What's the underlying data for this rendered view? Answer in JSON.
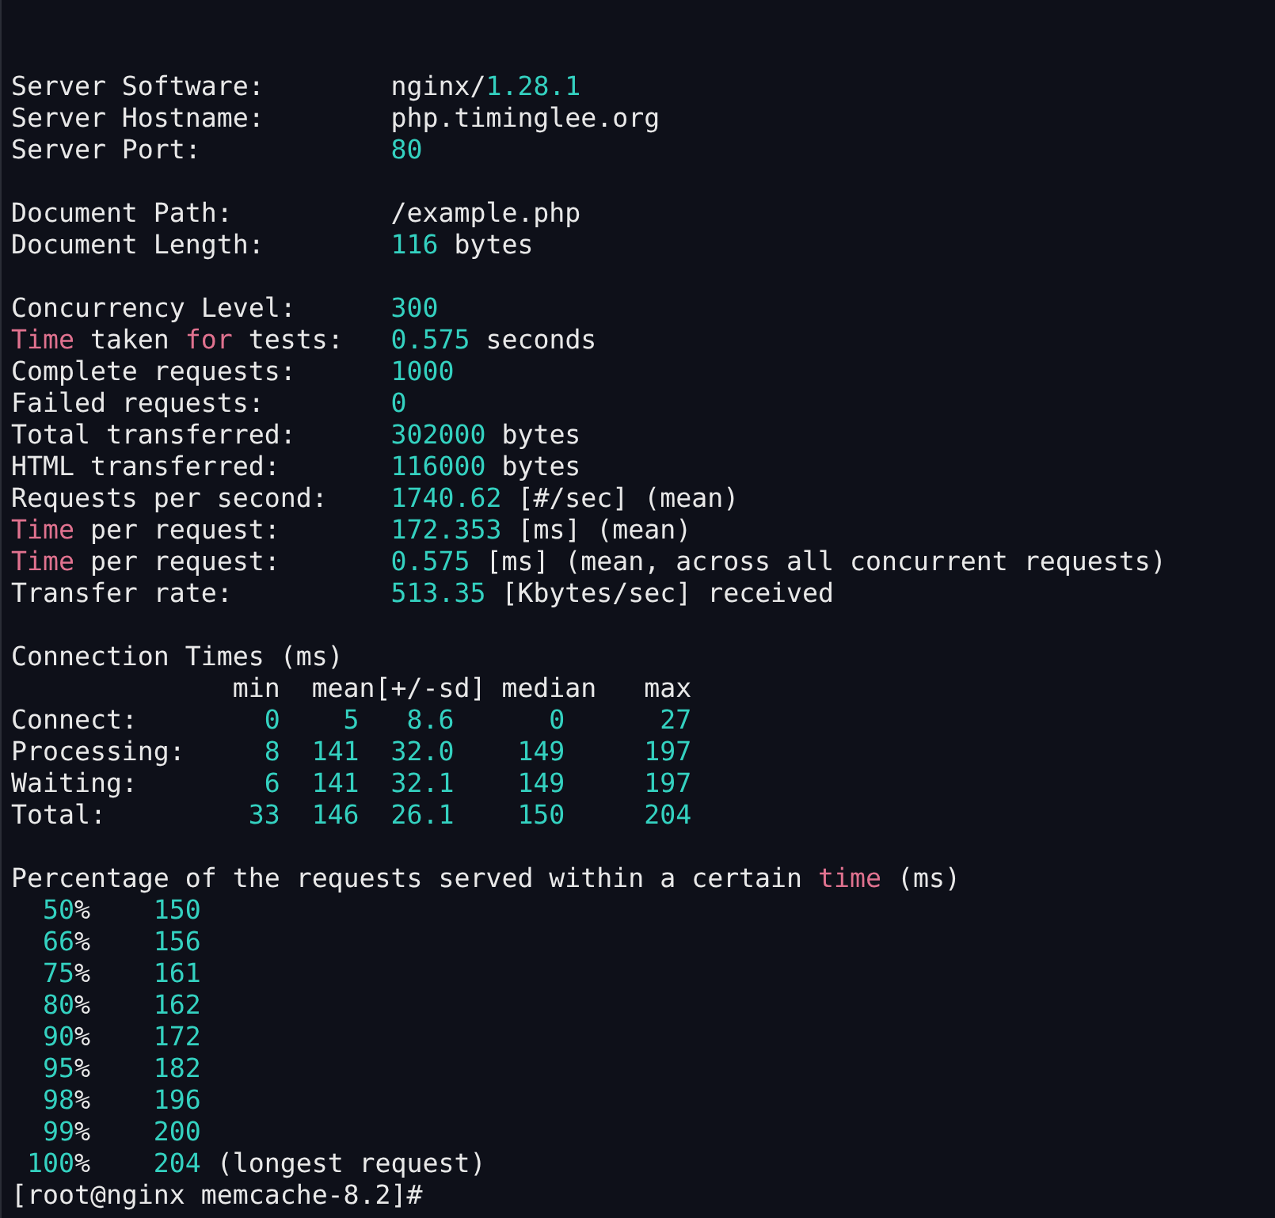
{
  "terminal": {
    "lines": [
      {
        "kind": "text",
        "segments": [
          {
            "kind": "plain",
            "text": "Server Software:        nginx/"
          },
          {
            "kind": "number",
            "text": "1.28.1"
          }
        ]
      },
      {
        "kind": "text",
        "segments": [
          {
            "kind": "plain",
            "text": "Server Hostname:        php.timinglee.org"
          }
        ]
      },
      {
        "kind": "text",
        "segments": [
          {
            "kind": "plain",
            "text": "Server Port:            "
          },
          {
            "kind": "number",
            "text": "80"
          }
        ]
      },
      {
        "kind": "blank"
      },
      {
        "kind": "text",
        "segments": [
          {
            "kind": "plain",
            "text": "Document Path:          /example.php"
          }
        ]
      },
      {
        "kind": "text",
        "segments": [
          {
            "kind": "plain",
            "text": "Document Length:        "
          },
          {
            "kind": "number",
            "text": "116"
          },
          {
            "kind": "plain",
            "text": " bytes"
          }
        ]
      },
      {
        "kind": "blank"
      },
      {
        "kind": "text",
        "segments": [
          {
            "kind": "plain",
            "text": "Concurrency Level:      "
          },
          {
            "kind": "number",
            "text": "300"
          }
        ]
      },
      {
        "kind": "text",
        "segments": [
          {
            "kind": "keyword",
            "text": "Time"
          },
          {
            "kind": "plain",
            "text": " taken "
          },
          {
            "kind": "keyword",
            "text": "for"
          },
          {
            "kind": "plain",
            "text": " tests:   "
          },
          {
            "kind": "number",
            "text": "0.575"
          },
          {
            "kind": "plain",
            "text": " seconds"
          }
        ]
      },
      {
        "kind": "text",
        "segments": [
          {
            "kind": "plain",
            "text": "Complete requests:      "
          },
          {
            "kind": "number",
            "text": "1000"
          }
        ]
      },
      {
        "kind": "text",
        "segments": [
          {
            "kind": "plain",
            "text": "Failed requests:        "
          },
          {
            "kind": "number",
            "text": "0"
          }
        ]
      },
      {
        "kind": "text",
        "segments": [
          {
            "kind": "plain",
            "text": "Total transferred:      "
          },
          {
            "kind": "number",
            "text": "302000"
          },
          {
            "kind": "plain",
            "text": " bytes"
          }
        ]
      },
      {
        "kind": "text",
        "segments": [
          {
            "kind": "plain",
            "text": "HTML transferred:       "
          },
          {
            "kind": "number",
            "text": "116000"
          },
          {
            "kind": "plain",
            "text": " bytes"
          }
        ]
      },
      {
        "kind": "text",
        "segments": [
          {
            "kind": "plain",
            "text": "Requests per second:    "
          },
          {
            "kind": "number",
            "text": "1740.62"
          },
          {
            "kind": "plain",
            "text": " [#/sec] (mean)"
          }
        ]
      },
      {
        "kind": "text",
        "segments": [
          {
            "kind": "keyword",
            "text": "Time"
          },
          {
            "kind": "plain",
            "text": " per request:       "
          },
          {
            "kind": "number",
            "text": "172.353"
          },
          {
            "kind": "plain",
            "text": " [ms] (mean)"
          }
        ]
      },
      {
        "kind": "text",
        "segments": [
          {
            "kind": "keyword",
            "text": "Time"
          },
          {
            "kind": "plain",
            "text": " per request:       "
          },
          {
            "kind": "number",
            "text": "0.575"
          },
          {
            "kind": "plain",
            "text": " [ms] (mean, across all concurrent requests)"
          }
        ]
      },
      {
        "kind": "text",
        "segments": [
          {
            "kind": "plain",
            "text": "Transfer rate:          "
          },
          {
            "kind": "number",
            "text": "513.35"
          },
          {
            "kind": "plain",
            "text": " [Kbytes/sec] received"
          }
        ]
      },
      {
        "kind": "blank"
      },
      {
        "kind": "text",
        "segments": [
          {
            "kind": "plain",
            "text": "Connection Times (ms)"
          }
        ]
      },
      {
        "kind": "text",
        "segments": [
          {
            "kind": "plain",
            "text": "              min  mean[+/-sd] median   max"
          }
        ]
      },
      {
        "kind": "text",
        "segments": [
          {
            "kind": "plain",
            "text": "Connect:        "
          },
          {
            "kind": "number",
            "text": "0    5   8.6      0      27"
          }
        ]
      },
      {
        "kind": "text",
        "segments": [
          {
            "kind": "plain",
            "text": "Processing:     "
          },
          {
            "kind": "number",
            "text": "8  141  32.0    149     197"
          }
        ]
      },
      {
        "kind": "text",
        "segments": [
          {
            "kind": "plain",
            "text": "Waiting:        "
          },
          {
            "kind": "number",
            "text": "6  141  32.1    149     197"
          }
        ]
      },
      {
        "kind": "text",
        "segments": [
          {
            "kind": "plain",
            "text": "Total:         "
          },
          {
            "kind": "number",
            "text": "33  146  26.1    150     204"
          }
        ]
      },
      {
        "kind": "blank"
      },
      {
        "kind": "text",
        "segments": [
          {
            "kind": "plain",
            "text": "Percentage of the requests served within a certain "
          },
          {
            "kind": "keyword",
            "text": "time"
          },
          {
            "kind": "plain",
            "text": " (ms)"
          }
        ]
      },
      {
        "kind": "percentile",
        "segments": [
          {
            "kind": "number",
            "text": "50"
          },
          {
            "kind": "plain",
            "text": "%    "
          },
          {
            "kind": "number",
            "text": "150"
          }
        ]
      },
      {
        "kind": "percentile",
        "segments": [
          {
            "kind": "number",
            "text": "66"
          },
          {
            "kind": "plain",
            "text": "%    "
          },
          {
            "kind": "number",
            "text": "156"
          }
        ]
      },
      {
        "kind": "percentile",
        "segments": [
          {
            "kind": "number",
            "text": "75"
          },
          {
            "kind": "plain",
            "text": "%    "
          },
          {
            "kind": "number",
            "text": "161"
          }
        ]
      },
      {
        "kind": "percentile",
        "segments": [
          {
            "kind": "number",
            "text": "80"
          },
          {
            "kind": "plain",
            "text": "%    "
          },
          {
            "kind": "number",
            "text": "162"
          }
        ]
      },
      {
        "kind": "percentile",
        "segments": [
          {
            "kind": "number",
            "text": "90"
          },
          {
            "kind": "plain",
            "text": "%    "
          },
          {
            "kind": "number",
            "text": "172"
          }
        ]
      },
      {
        "kind": "percentile",
        "segments": [
          {
            "kind": "number",
            "text": "95"
          },
          {
            "kind": "plain",
            "text": "%    "
          },
          {
            "kind": "number",
            "text": "182"
          }
        ]
      },
      {
        "kind": "percentile",
        "segments": [
          {
            "kind": "number",
            "text": "98"
          },
          {
            "kind": "plain",
            "text": "%    "
          },
          {
            "kind": "number",
            "text": "196"
          }
        ]
      },
      {
        "kind": "percentile",
        "segments": [
          {
            "kind": "number",
            "text": "99"
          },
          {
            "kind": "plain",
            "text": "%    "
          },
          {
            "kind": "number",
            "text": "200"
          }
        ]
      },
      {
        "kind": "percentile",
        "segments": [
          {
            "kind": "number",
            "text": "100"
          },
          {
            "kind": "plain",
            "text": "%    "
          },
          {
            "kind": "number",
            "text": "204"
          },
          {
            "kind": "plain",
            "text": " (longest request)"
          }
        ]
      },
      {
        "kind": "prompt",
        "segments": [
          {
            "kind": "plain",
            "text": "[root@nginx memcache-8.2]#"
          }
        ]
      }
    ]
  }
}
